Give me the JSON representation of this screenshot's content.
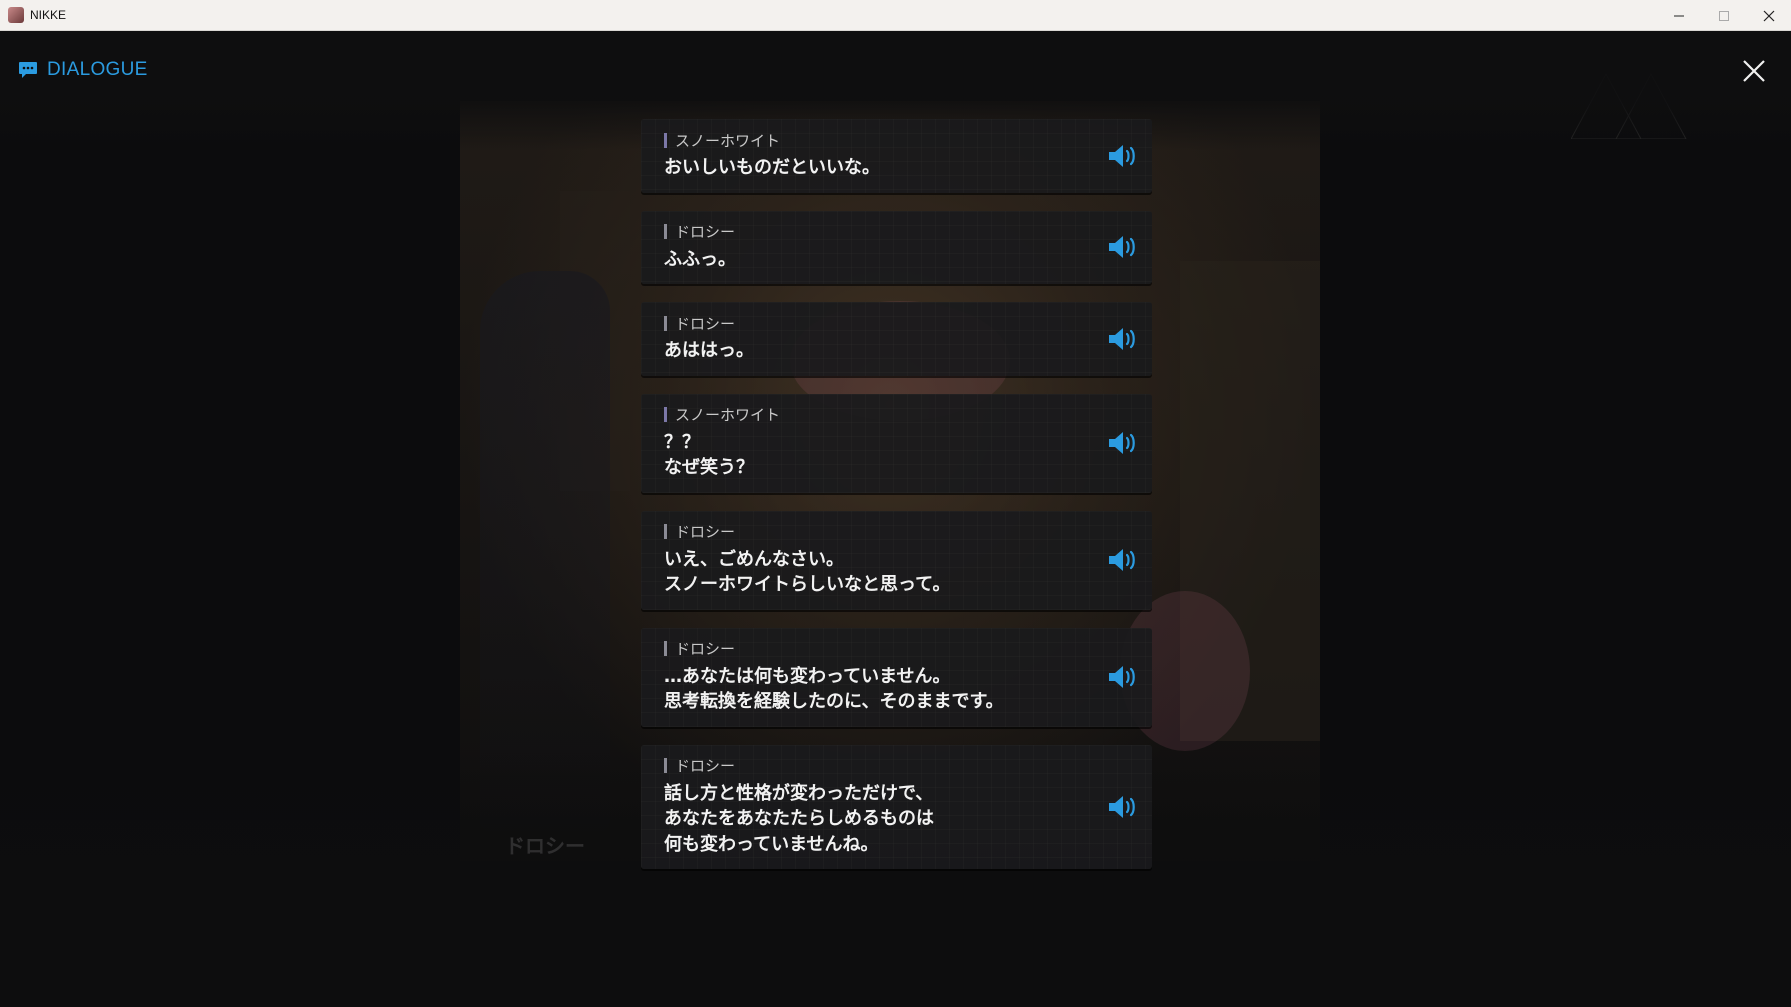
{
  "window": {
    "title": "NIKKE",
    "controls": [
      "minimize",
      "maximize",
      "close"
    ]
  },
  "header": {
    "icon": "chat-bubble-icon",
    "title": "DIALOGUE",
    "accent_color": "#2b9be0"
  },
  "close_icon": "close-icon",
  "dialogue": [
    {
      "speaker": "スノーホワイト",
      "text": "おいしいものだといいな。"
    },
    {
      "speaker": "ドロシー",
      "text": "ふふっ。"
    },
    {
      "speaker": "ドロシー",
      "text": "あははっ。"
    },
    {
      "speaker": "スノーホワイト",
      "text": "？？\nなぜ笑う？"
    },
    {
      "speaker": "ドロシー",
      "text": "いえ、ごめんなさい。\nスノーホワイトらしいなと思って。"
    },
    {
      "speaker": "ドロシー",
      "text": "…あなたは何も変わっていません。\n思考転換を経験したのに、そのままです。"
    },
    {
      "speaker": "ドロシー",
      "text": "話し方と性格が変わっただけで、\nあなたをあなたたらしめるものは\n何も変わっていませんね。"
    }
  ],
  "voice_icon": "speaker-volume-icon"
}
